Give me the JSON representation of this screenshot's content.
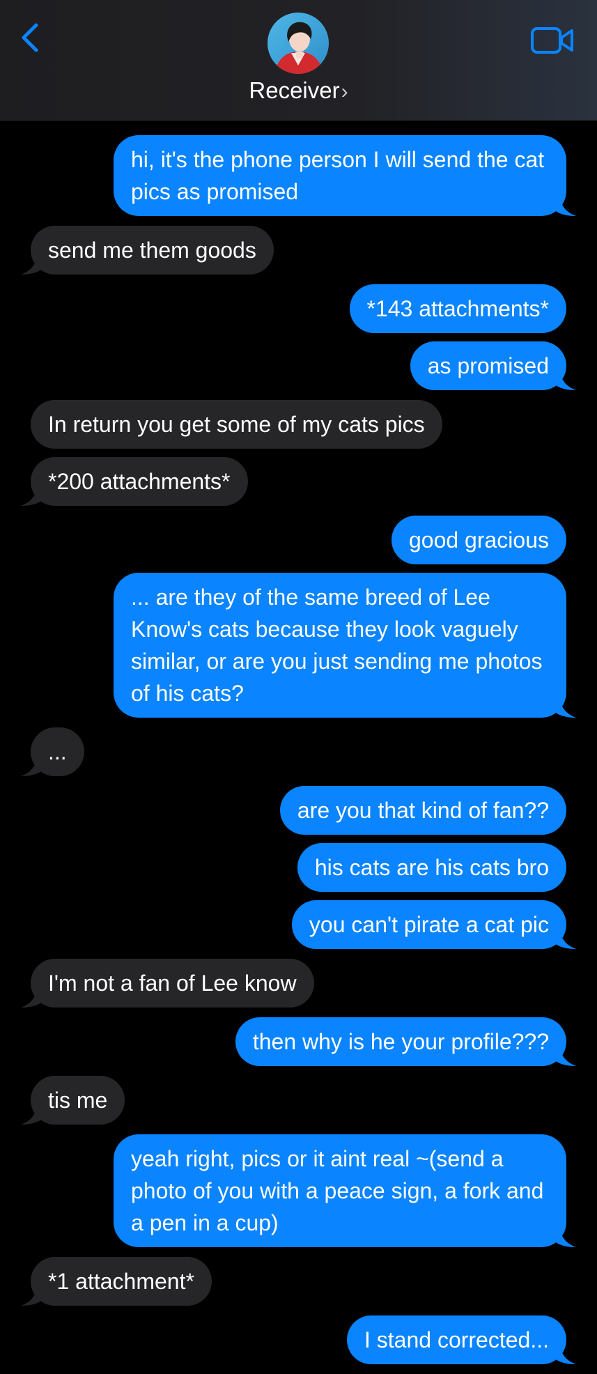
{
  "header": {
    "contact_name": "Receiver",
    "chevron": "›",
    "back_icon": "chevron-left-icon",
    "video_icon": "video-camera-icon",
    "accent_color": "#0a84ff"
  },
  "colors": {
    "sent_bubble": "#0a84ff",
    "received_bubble": "#262629",
    "background": "#000000"
  },
  "messages": [
    {
      "side": "sent",
      "text": "hi, it's the phone person I will send the cat pics as promised",
      "tail": true
    },
    {
      "side": "received",
      "text": "send me them goods",
      "tail": true
    },
    {
      "side": "sent",
      "text": "*143 attachments*",
      "tail": false
    },
    {
      "side": "sent",
      "text": "as promised",
      "tail": true
    },
    {
      "side": "received",
      "text": "In return you get some of my cats pics",
      "tail": false
    },
    {
      "side": "received",
      "text": "*200 attachments*",
      "tail": true
    },
    {
      "side": "sent",
      "text": "good gracious",
      "tail": false
    },
    {
      "side": "sent",
      "text": "... are they of the same breed of Lee Know's cats because they look vaguely similar, or are you just sending me photos of his cats?",
      "tail": true
    },
    {
      "side": "received",
      "text": "...",
      "tail": true
    },
    {
      "side": "sent",
      "text": "are you that kind of fan??",
      "tail": false
    },
    {
      "side": "sent",
      "text": "his cats are his cats bro",
      "tail": false
    },
    {
      "side": "sent",
      "text": "you can't pirate a cat pic",
      "tail": true
    },
    {
      "side": "received",
      "text": "I'm not a fan of Lee know",
      "tail": true
    },
    {
      "side": "sent",
      "text": "then why is he your profile???",
      "tail": true
    },
    {
      "side": "received",
      "text": "tis me",
      "tail": true
    },
    {
      "side": "sent",
      "text": "yeah right, pics or it aint real ~(send a photo of you with a peace sign, a fork and a pen in a cup)",
      "tail": true
    },
    {
      "side": "received",
      "text": "*1 attachment*",
      "tail": true
    },
    {
      "side": "sent",
      "text": "I stand corrected...",
      "tail": true
    }
  ]
}
